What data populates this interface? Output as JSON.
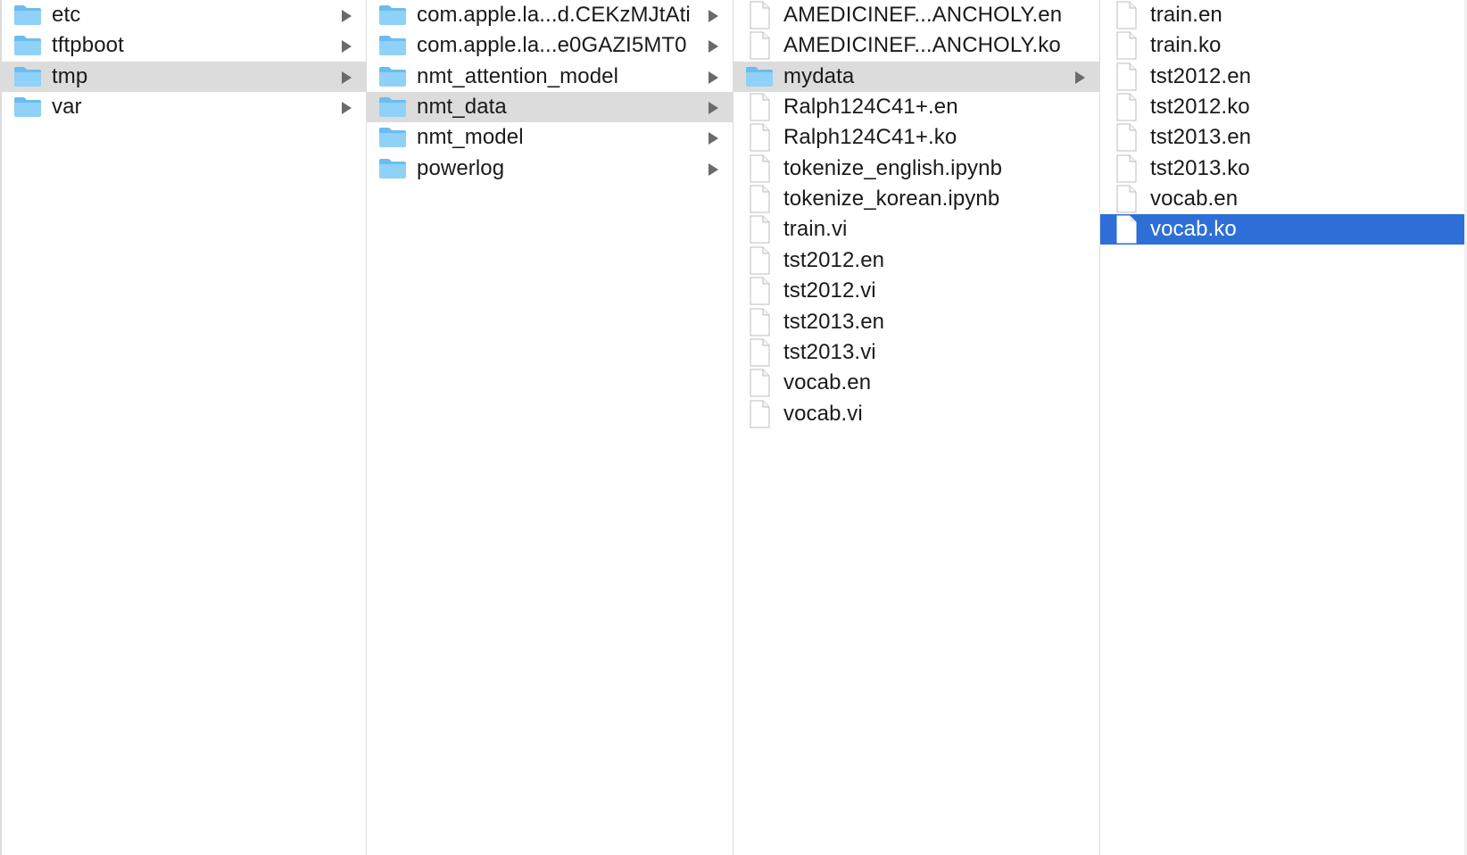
{
  "columns": [
    {
      "items": [
        {
          "name": "etc",
          "kind": "folder",
          "has_children": true,
          "selection": ""
        },
        {
          "name": "tftpboot",
          "kind": "folder",
          "has_children": true,
          "selection": ""
        },
        {
          "name": "tmp",
          "kind": "folder",
          "has_children": true,
          "selection": "inactive"
        },
        {
          "name": "var",
          "kind": "folder",
          "has_children": true,
          "selection": ""
        }
      ]
    },
    {
      "items": [
        {
          "name": "com.apple.la...d.CEKzMJtAti",
          "kind": "folder",
          "has_children": true,
          "selection": ""
        },
        {
          "name": "com.apple.la...e0GAZI5MT0",
          "kind": "folder",
          "has_children": true,
          "selection": ""
        },
        {
          "name": "nmt_attention_model",
          "kind": "folder",
          "has_children": true,
          "selection": ""
        },
        {
          "name": "nmt_data",
          "kind": "folder",
          "has_children": true,
          "selection": "inactive"
        },
        {
          "name": "nmt_model",
          "kind": "folder",
          "has_children": true,
          "selection": ""
        },
        {
          "name": "powerlog",
          "kind": "folder",
          "has_children": true,
          "selection": ""
        }
      ]
    },
    {
      "items": [
        {
          "name": "AMEDICINEF...ANCHOLY.en",
          "kind": "file",
          "has_children": false,
          "selection": ""
        },
        {
          "name": "AMEDICINEF...ANCHOLY.ko",
          "kind": "file",
          "has_children": false,
          "selection": ""
        },
        {
          "name": "mydata",
          "kind": "folder",
          "has_children": true,
          "selection": "inactive"
        },
        {
          "name": "Ralph124C41+.en",
          "kind": "file",
          "has_children": false,
          "selection": ""
        },
        {
          "name": "Ralph124C41+.ko",
          "kind": "file",
          "has_children": false,
          "selection": ""
        },
        {
          "name": "tokenize_english.ipynb",
          "kind": "file",
          "has_children": false,
          "selection": ""
        },
        {
          "name": "tokenize_korean.ipynb",
          "kind": "file",
          "has_children": false,
          "selection": ""
        },
        {
          "name": "train.vi",
          "kind": "file",
          "has_children": false,
          "selection": ""
        },
        {
          "name": "tst2012.en",
          "kind": "file",
          "has_children": false,
          "selection": ""
        },
        {
          "name": "tst2012.vi",
          "kind": "file",
          "has_children": false,
          "selection": ""
        },
        {
          "name": "tst2013.en",
          "kind": "file",
          "has_children": false,
          "selection": ""
        },
        {
          "name": "tst2013.vi",
          "kind": "file",
          "has_children": false,
          "selection": ""
        },
        {
          "name": "vocab.en",
          "kind": "file",
          "has_children": false,
          "selection": ""
        },
        {
          "name": "vocab.vi",
          "kind": "file",
          "has_children": false,
          "selection": ""
        }
      ]
    },
    {
      "items": [
        {
          "name": "train.en",
          "kind": "file",
          "has_children": false,
          "selection": ""
        },
        {
          "name": "train.ko",
          "kind": "file",
          "has_children": false,
          "selection": ""
        },
        {
          "name": "tst2012.en",
          "kind": "file",
          "has_children": false,
          "selection": ""
        },
        {
          "name": "tst2012.ko",
          "kind": "file",
          "has_children": false,
          "selection": ""
        },
        {
          "name": "tst2013.en",
          "kind": "file",
          "has_children": false,
          "selection": ""
        },
        {
          "name": "tst2013.ko",
          "kind": "file",
          "has_children": false,
          "selection": ""
        },
        {
          "name": "vocab.en",
          "kind": "file",
          "has_children": false,
          "selection": ""
        },
        {
          "name": "vocab.ko",
          "kind": "file",
          "has_children": false,
          "selection": "active"
        }
      ]
    }
  ],
  "icons": {
    "folder": "folder-icon",
    "file": "file-icon",
    "disclosure": "chevron-right-icon"
  },
  "colors": {
    "selection_active": "#2d6fd6",
    "selection_inactive": "#dcdcdc",
    "folder_fill": "#8fd1f7",
    "folder_tab": "#6bbcf0",
    "text": "#1a1a1a"
  }
}
